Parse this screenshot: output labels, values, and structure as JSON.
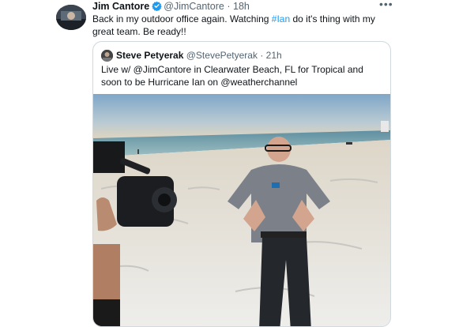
{
  "tweet": {
    "author_name": "Jim Cantore",
    "author_handle": "@JimCantore",
    "separator": "·",
    "time": "18h",
    "more_icon": "more-icon",
    "text_before": "Back in my outdoor office again.  Watching ",
    "hashtag": "#Ian",
    "text_after": " do it's thing with my great team.  Be ready!!"
  },
  "quote": {
    "author_name": "Steve Petyerak",
    "author_handle": "@StevePetyerak",
    "separator": "·",
    "time": "21h",
    "text": "Live w/ @JimCantore in Clearwater Beach, FL for Tropical and soon to be Hurricane Ian on @weatherchannel"
  },
  "colors": {
    "link": "#1d9bf0",
    "verified": "#1d9bf0",
    "muted": "#536471",
    "border": "#cfd9de"
  }
}
